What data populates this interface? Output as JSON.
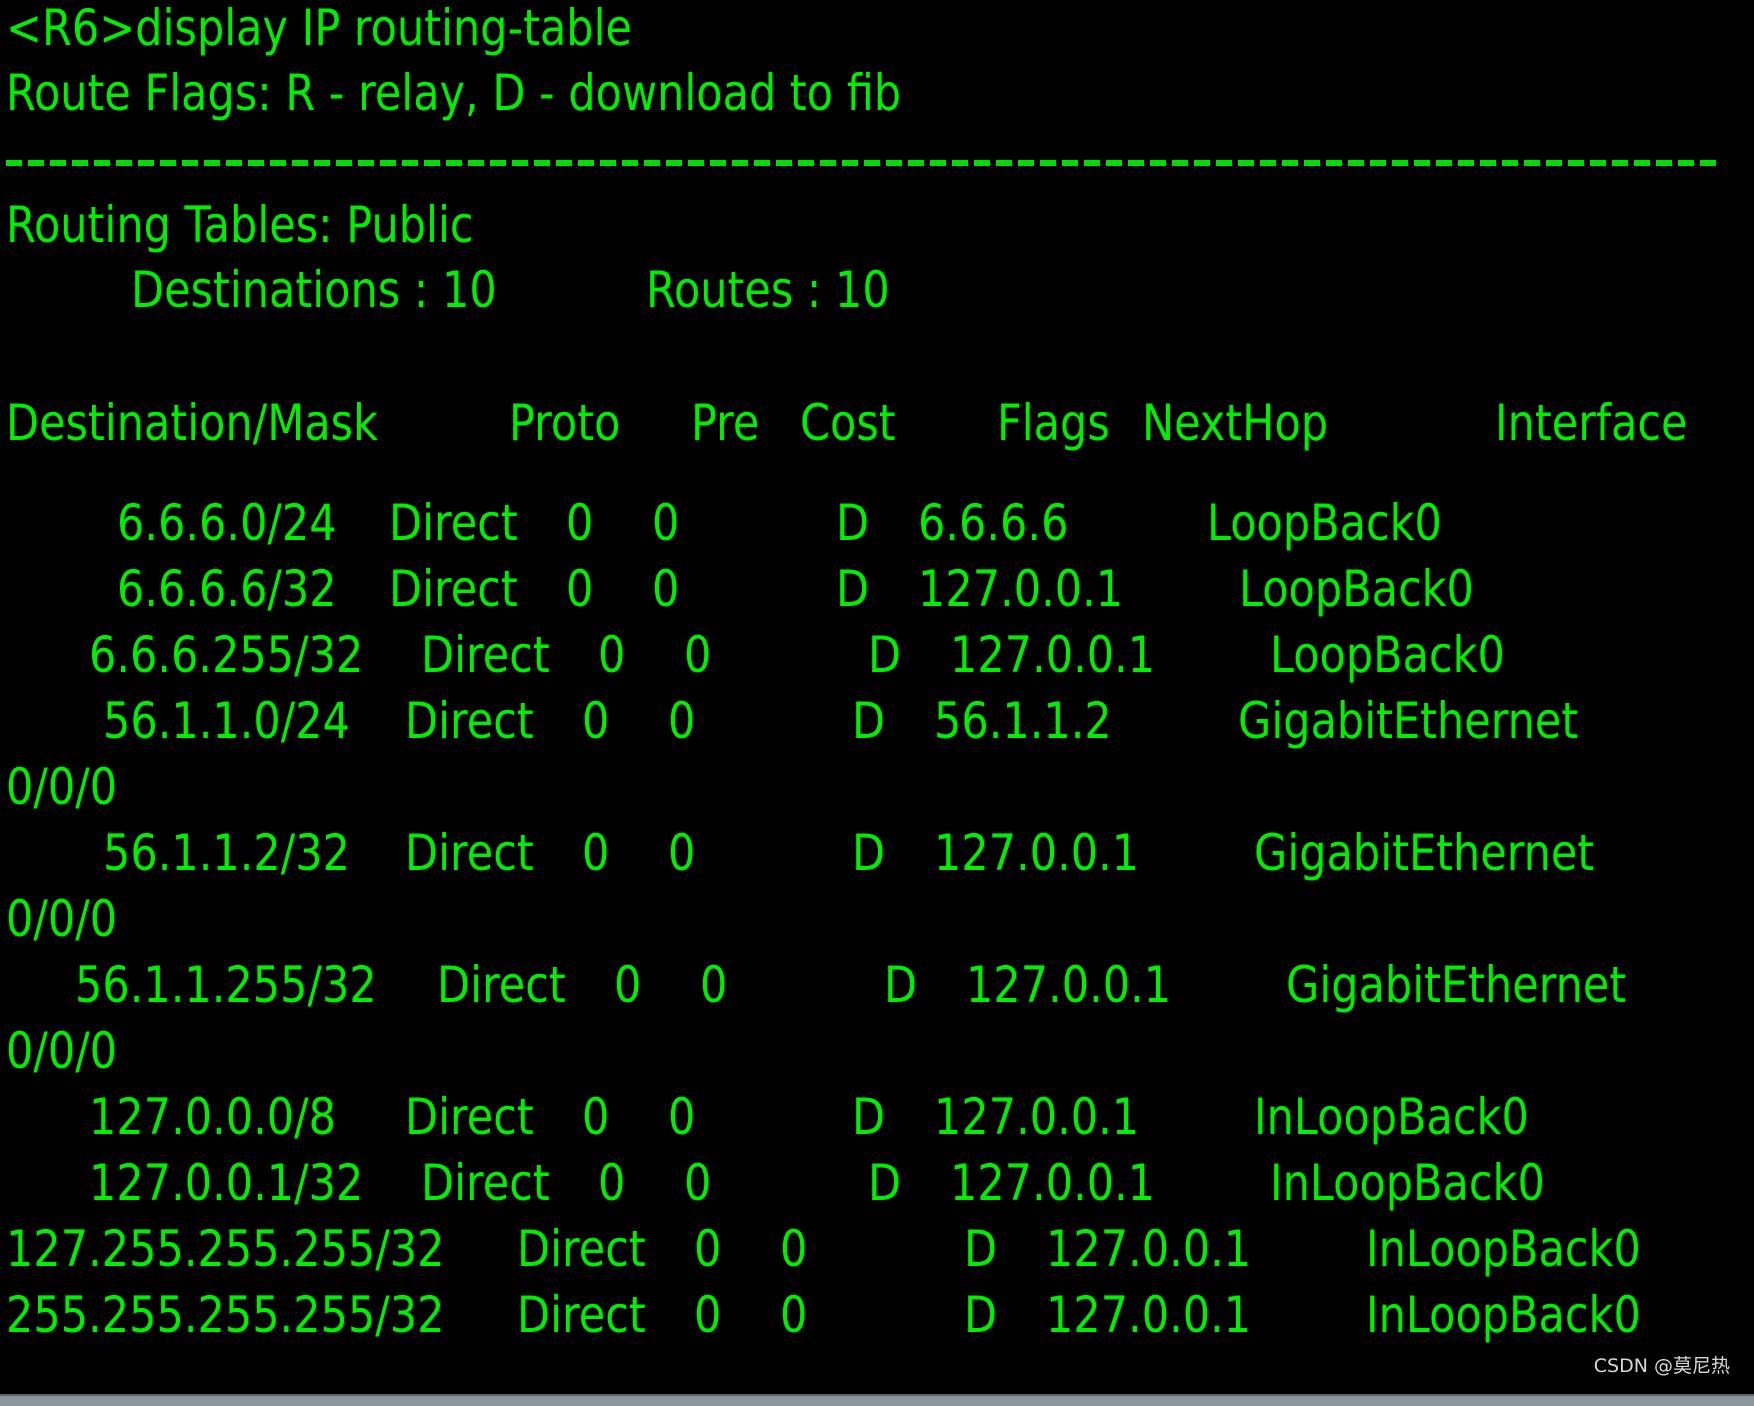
{
  "terminal": {
    "prompt": "<R6>display IP routing-table",
    "flags_legend": "Route Flags: R - relay, D - download to fib",
    "table_title": "Routing Tables: Public",
    "destinations_label": "Destinations : 10",
    "routes_label": "Routes : 10",
    "headers": {
      "destination_mask": "Destination/Mask",
      "proto": "Proto",
      "pre": "Pre",
      "cost": "Cost",
      "flags": "Flags",
      "nexthop": "NextHop",
      "interface": "Interface"
    },
    "routes": [
      {
        "dest": "6.6.6.0/24",
        "proto": "Direct",
        "pre": "0",
        "cost": "0",
        "flags": "D",
        "nexthop": "6.6.6.6",
        "interface": "LoopBack0",
        "interface_cont": ""
      },
      {
        "dest": "6.6.6.6/32",
        "proto": "Direct",
        "pre": "0",
        "cost": "0",
        "flags": "D",
        "nexthop": "127.0.0.1",
        "interface": "LoopBack0",
        "interface_cont": ""
      },
      {
        "dest": "6.6.6.255/32",
        "proto": "Direct",
        "pre": "0",
        "cost": "0",
        "flags": "D",
        "nexthop": "127.0.0.1",
        "interface": "LoopBack0",
        "interface_cont": ""
      },
      {
        "dest": "56.1.1.0/24",
        "proto": "Direct",
        "pre": "0",
        "cost": "0",
        "flags": "D",
        "nexthop": "56.1.1.2",
        "interface": "GigabitEthernet",
        "interface_cont": "0/0/0"
      },
      {
        "dest": "56.1.1.2/32",
        "proto": "Direct",
        "pre": "0",
        "cost": "0",
        "flags": "D",
        "nexthop": "127.0.0.1",
        "interface": "GigabitEthernet",
        "interface_cont": "0/0/0"
      },
      {
        "dest": "56.1.1.255/32",
        "proto": "Direct",
        "pre": "0",
        "cost": "0",
        "flags": "D",
        "nexthop": "127.0.0.1",
        "interface": "GigabitEthernet",
        "interface_cont": "0/0/0"
      },
      {
        "dest": "127.0.0.0/8",
        "proto": "Direct",
        "pre": "0",
        "cost": "0",
        "flags": "D",
        "nexthop": "127.0.0.1",
        "interface": "InLoopBack0",
        "interface_cont": ""
      },
      {
        "dest": "127.0.0.1/32",
        "proto": "Direct",
        "pre": "0",
        "cost": "0",
        "flags": "D",
        "nexthop": "127.0.0.1",
        "interface": "InLoopBack0",
        "interface_cont": ""
      },
      {
        "dest": "127.255.255.255/32",
        "proto": "Direct",
        "pre": "0",
        "cost": "0",
        "flags": "D",
        "nexthop": "127.0.0.1",
        "interface": "InLoopBack0",
        "interface_cont": ""
      },
      {
        "dest": "255.255.255.255/32",
        "proto": "Direct",
        "pre": "0",
        "cost": "0",
        "flags": "D",
        "nexthop": "127.0.0.1",
        "interface": "InLoopBack0",
        "interface_cont": ""
      }
    ]
  },
  "watermark": "CSDN @莫尼热",
  "colors": {
    "text": "#00ee00",
    "background": "#000000"
  }
}
